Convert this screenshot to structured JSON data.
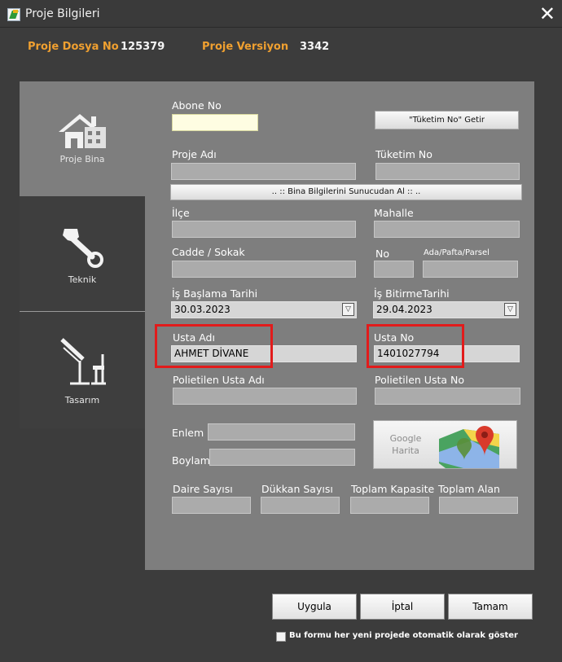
{
  "window": {
    "title": "Proje Bilgileri",
    "close_symbol": "✕"
  },
  "header": {
    "dosya_label": "Proje Dosya No",
    "dosya_value": "125379",
    "versiyon_label": "Proje Versiyon",
    "versiyon_value": "3342"
  },
  "tabs": [
    {
      "label": "Proje Bina",
      "icon": "house-icon",
      "active": true
    },
    {
      "label": "Teknik",
      "icon": "wrench-icon",
      "active": false
    },
    {
      "label": "Tasarım",
      "icon": "drafting-table-icon",
      "active": false
    }
  ],
  "form": {
    "abone_no_label": "Abone No",
    "abone_no_value": "",
    "tuketim_getir_button": "\"Tüketim No\" Getir",
    "proje_adi_label": "Proje Adı",
    "proje_adi_value": "",
    "tuketim_no_label": "Tüketim No",
    "tuketim_no_value": "",
    "bina_bilgileri_button": ".. :: Bina Bilgilerini Sunucudan Al :: ..",
    "ilce_label": "İlçe",
    "ilce_value": "",
    "mahalle_label": "Mahalle",
    "mahalle_value": "",
    "cadde_label": "Cadde / Sokak",
    "cadde_value": "",
    "no_label": "No",
    "no_value": "",
    "ada_label": "Ada/Pafta/Parsel",
    "ada_value": "",
    "baslama_label": "İş Başlama Tarihi",
    "baslama_value": "30.03.2023",
    "bitirme_label": "İş BitirmeTarihi",
    "bitirme_value": "29.04.2023",
    "dropdown_symbol": "▽",
    "usta_adi_label": "Usta Adı",
    "usta_adi_value": "AHMET DİVANE",
    "usta_no_label": "Usta No",
    "usta_no_value": "1401027794",
    "pol_usta_adi_label": "Polietilen Usta Adı",
    "pol_usta_adi_value": "",
    "pol_usta_no_label": "Polietilen Usta No",
    "pol_usta_no_value": "",
    "enlem_label": "Enlem",
    "enlem_value": "",
    "boylam_label": "Boylam",
    "boylam_value": "",
    "google_harita_label": "Google\nHarita",
    "daire_label": "Daire Sayısı",
    "daire_value": "",
    "dukkan_label": "Dükkan Sayısı",
    "dukkan_value": "",
    "kapasite_label": "Toplam Kapasite",
    "kapasite_value": "",
    "alan_label": "Toplam Alan",
    "alan_value": ""
  },
  "buttons": {
    "uygula": "Uygula",
    "iptal": "İptal",
    "tamam": "Tamam"
  },
  "checkbox": {
    "label": "Bu formu her yeni projede otomatik olarak göster",
    "checked": false
  },
  "colors": {
    "accent": "#f0a030",
    "highlight": "#e21b1b",
    "panel": "#7e7e7e",
    "background": "#3c3c3c"
  }
}
